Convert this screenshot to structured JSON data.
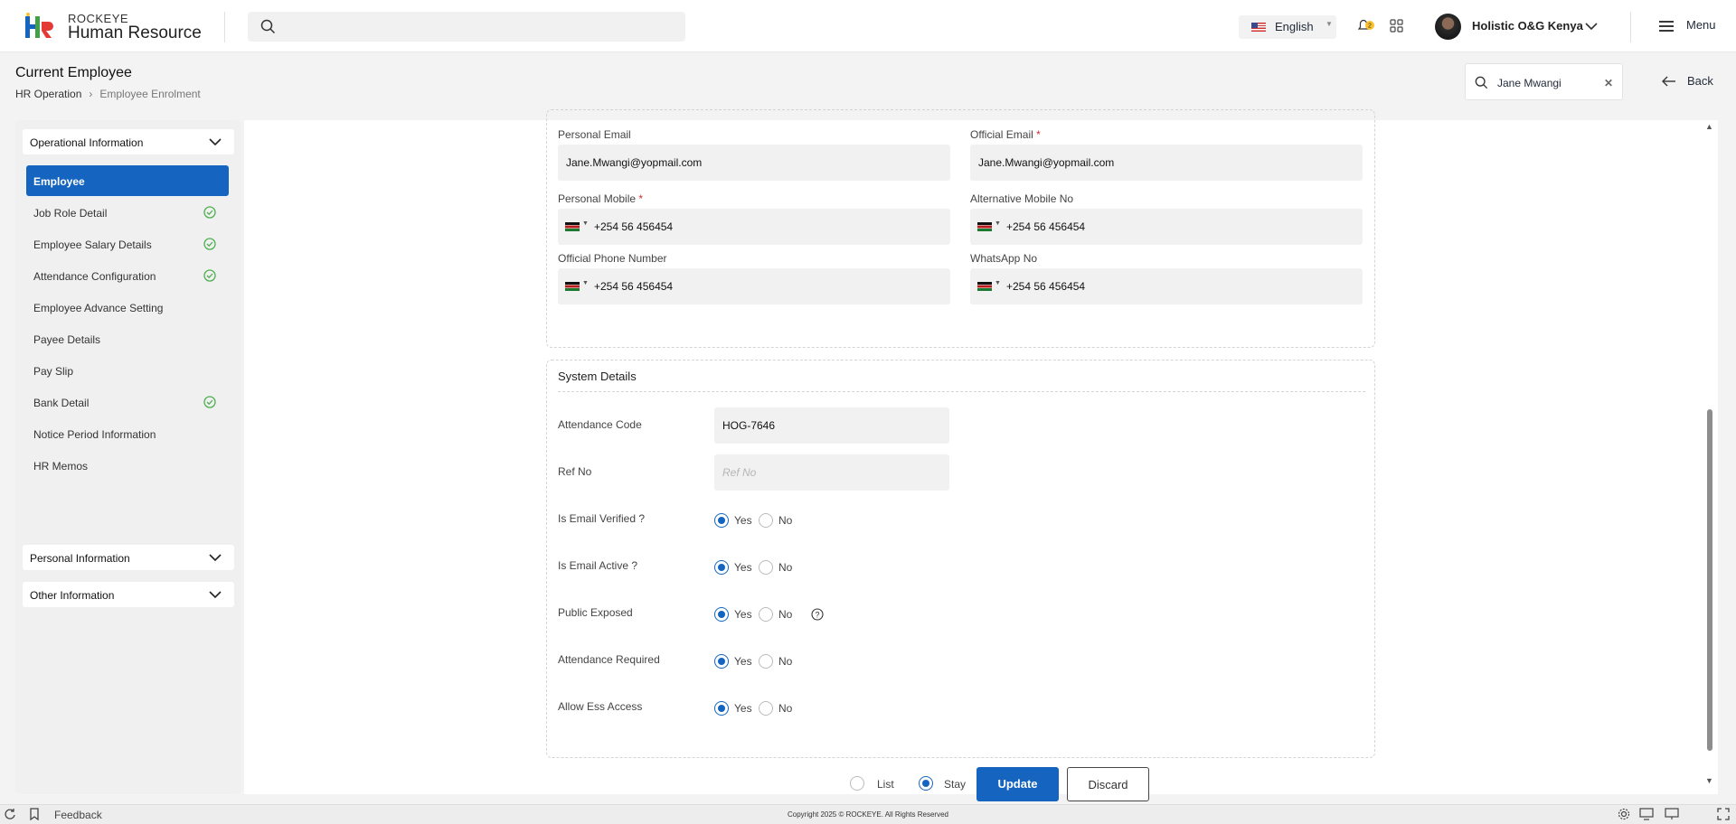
{
  "header": {
    "brand_top": "ROCKEYE",
    "brand_main": "Human Resource",
    "language": "English",
    "notification_count": "2",
    "user_name": "Holistic O&G Kenya",
    "menu_label": "Menu"
  },
  "page": {
    "title": "Current Employee",
    "breadcrumb": [
      "HR Operation",
      "Employee Enrolment"
    ],
    "employee_search": "Jane Mwangi",
    "back_label": "Back"
  },
  "sidebar": {
    "group1": "Operational Information",
    "items": [
      {
        "label": "Employee",
        "active": true,
        "done": false
      },
      {
        "label": "Job Role Detail",
        "active": false,
        "done": true
      },
      {
        "label": "Employee Salary Details",
        "active": false,
        "done": true
      },
      {
        "label": "Attendance Configuration",
        "active": false,
        "done": true
      },
      {
        "label": "Employee Advance Setting",
        "active": false,
        "done": false
      },
      {
        "label": "Payee Details",
        "active": false,
        "done": false
      },
      {
        "label": "Pay Slip",
        "active": false,
        "done": false
      },
      {
        "label": "Bank Detail",
        "active": false,
        "done": true
      },
      {
        "label": "Notice Period Information",
        "active": false,
        "done": false
      },
      {
        "label": "HR Memos",
        "active": false,
        "done": false
      }
    ],
    "group2": "Personal Information",
    "group3": "Other Information"
  },
  "contact": {
    "personal_email_label": "Personal Email",
    "personal_email": "Jane.Mwangi@yopmail.com",
    "official_email_label": "Official Email",
    "official_email": "Jane.Mwangi@yopmail.com",
    "personal_mobile_label": "Personal Mobile",
    "personal_mobile": "+254 56 456454",
    "alt_mobile_label": "Alternative Mobile No",
    "alt_mobile": "+254 56 456454",
    "official_phone_label": "Official Phone Number",
    "official_phone": "+254 56 456454",
    "whatsapp_label": "WhatsApp No",
    "whatsapp": "+254 56 456454",
    "required_mark": "*"
  },
  "system": {
    "title": "System Details",
    "attendance_code_label": "Attendance Code",
    "attendance_code": "HOG-7646",
    "ref_no_label": "Ref No",
    "ref_no_placeholder": "Ref No",
    "yes": "Yes",
    "no": "No",
    "toggles": [
      {
        "label": "Is Email Verified ?",
        "value": "Yes"
      },
      {
        "label": "Is Email Active ?",
        "value": "Yes"
      },
      {
        "label": "Public Exposed",
        "value": "Yes"
      },
      {
        "label": "Attendance Required",
        "value": "Yes"
      },
      {
        "label": "Allow Ess Access",
        "value": "Yes"
      }
    ]
  },
  "actions": {
    "list_label": "List",
    "stay_label": "Stay",
    "selected": "Stay",
    "update_label": "Update",
    "discard_label": "Discard"
  },
  "footer": {
    "feedback": "Feedback",
    "copyright": "Copyright 2025 © ROCKEYE. All Rights Reserved"
  },
  "colors": {
    "primary": "#1565c0",
    "success": "#4caf50",
    "required": "#d32f2f"
  }
}
